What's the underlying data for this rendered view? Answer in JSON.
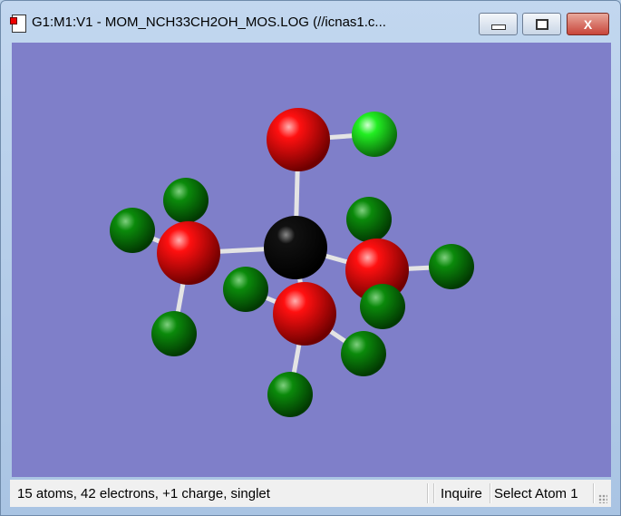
{
  "window": {
    "title": "G1:M1:V1 - MOM_NCH33CH2OH_MOS.LOG (//icnas1.c...",
    "minimize_label": "",
    "maximize_label": "",
    "close_label": "X"
  },
  "colors": {
    "background": "#7f7fc9",
    "oxygen": "#ff0000",
    "carbon": "#000000",
    "hydrogen_dark": "#0a8a0a",
    "hydrogen_light": "#33ff33",
    "bond": "#e8e8e8"
  },
  "statusbar": {
    "info": "15 atoms, 42 electrons, +1 charge, singlet",
    "mode": "Inquire",
    "selection": "Select Atom 1"
  }
}
